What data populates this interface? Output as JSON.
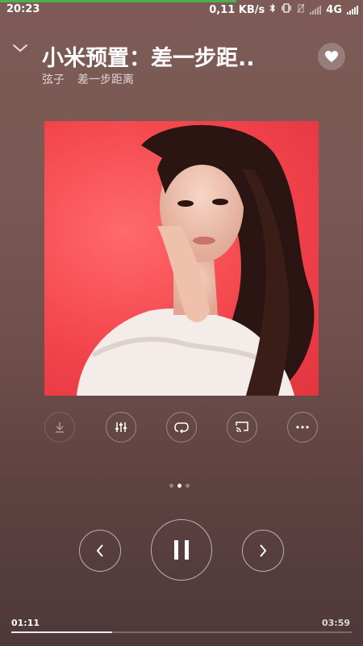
{
  "status_bar": {
    "time": "20:23",
    "net_speed": "0,11 KB/s",
    "network": "4G",
    "playback_fraction_top": 0.65
  },
  "player": {
    "title": "小米预置：差一步距..",
    "artist": "弦子",
    "album": "差一步距离",
    "liked": false
  },
  "actions": [
    {
      "name": "download",
      "icon": "download-icon",
      "enabled": false
    },
    {
      "name": "equalizer",
      "icon": "equalizer-icon",
      "enabled": true
    },
    {
      "name": "repeat",
      "icon": "repeat-icon",
      "enabled": true
    },
    {
      "name": "cast",
      "icon": "cast-icon",
      "enabled": true
    },
    {
      "name": "more",
      "icon": "more-icon",
      "enabled": true
    }
  ],
  "pager": {
    "count": 3,
    "active": 1
  },
  "playback": {
    "state": "playing",
    "current_time": "01:11",
    "total_time": "03:59",
    "progress_fraction": 0.297
  },
  "colors": {
    "accent_green": "#4caf50",
    "cover_red": "#f2434b"
  }
}
